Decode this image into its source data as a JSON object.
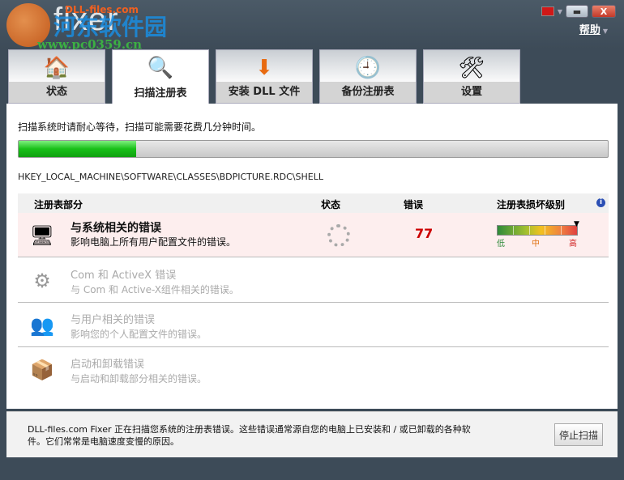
{
  "app": {
    "logo_brand": "DLL-files.com",
    "logo_name": "fixer",
    "watermark_cn": "河东软件园",
    "watermark_url": "www.pc0359.cn",
    "help": "帮助"
  },
  "tabs": [
    {
      "label": "状态",
      "icon": "house-icon"
    },
    {
      "label": "扫描注册表",
      "icon": "magnifier-icon"
    },
    {
      "label": "安装 DLL 文件",
      "icon": "download-drive-icon"
    },
    {
      "label": "备份注册表",
      "icon": "clock-backup-icon"
    },
    {
      "label": "设置",
      "icon": "tools-icon"
    }
  ],
  "scan": {
    "message": "扫描系统时请耐心等待，扫描可能需要花费几分钟时间。",
    "progress_percent": 20,
    "current_path": "HKEY_LOCAL_MACHINE\\SOFTWARE\\CLASSES\\BDPICTURE.RDC\\SHELL"
  },
  "table": {
    "headers": {
      "section": "注册表部分",
      "status": "状态",
      "errors": "错误",
      "severity": "注册表损坏级别"
    },
    "severity_labels": {
      "low": "低",
      "mid": "中",
      "high": "高"
    },
    "rows": [
      {
        "title": "与系统相关的错误",
        "desc": "影响电脑上所有用户配置文件的错误。",
        "errors": "77",
        "icon": "computer-icon"
      },
      {
        "title": "Com 和  ActiveX 错误",
        "desc": "与 Com 和 Active-X组件相关的错误。",
        "icon": "gears-icon"
      },
      {
        "title": "与用户相关的错误",
        "desc": "影响您的个人配置文件的错误。",
        "icon": "users-icon"
      },
      {
        "title": "启动和卸载错误",
        "desc": "与启动和卸载部分相关的错误。",
        "icon": "installer-box-icon"
      }
    ]
  },
  "footer": {
    "text": "DLL-files.com Fixer 正在扫描您系统的注册表错误。这些错误通常源自您的电脑上已安装和 / 或已卸载的各种软件。它们常常是电脑速度变慢的原因。",
    "stop_button": "停止扫描"
  },
  "colors": {
    "progress": "#18c018",
    "error": "#cc0000",
    "active_row": "#fdeeee"
  }
}
